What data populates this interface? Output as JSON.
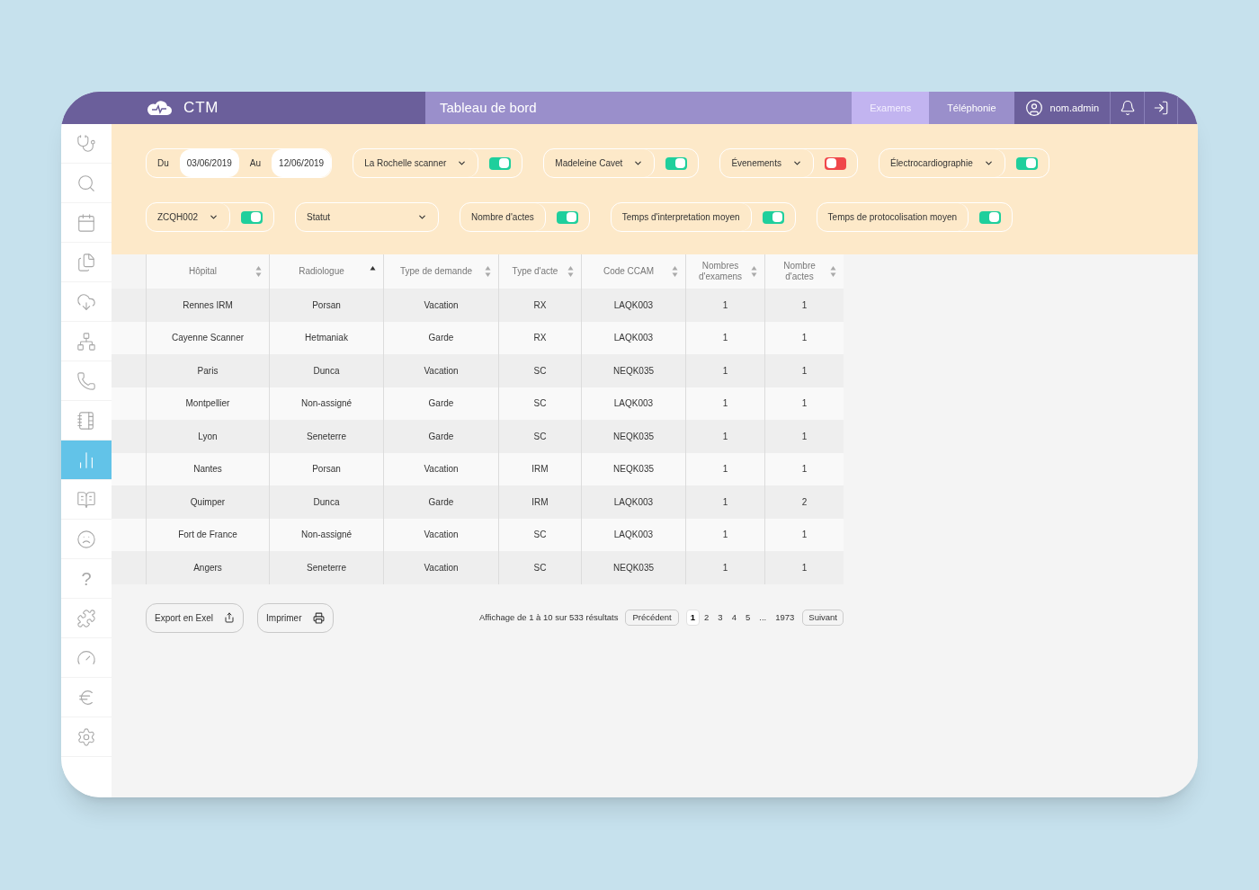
{
  "header": {
    "logo_text": "CTM",
    "title": "Tableau de bord",
    "tabs": [
      {
        "label": "Examens",
        "selected": true
      },
      {
        "label": "Téléphonie",
        "selected": false
      }
    ],
    "user": "nom.admin"
  },
  "sidebar": {
    "items": [
      {
        "selected": false
      },
      {
        "selected": false
      },
      {
        "selected": false
      },
      {
        "selected": false
      },
      {
        "selected": false
      },
      {
        "selected": false
      },
      {
        "selected": false
      },
      {
        "selected": false
      },
      {
        "selected": true
      },
      {
        "selected": false
      },
      {
        "selected": false
      },
      {
        "glyph": "?",
        "selected": false
      },
      {
        "selected": false
      },
      {
        "selected": false
      },
      {
        "selected": false
      },
      {
        "selected": false
      }
    ]
  },
  "filter_rows": [
    [
      {
        "kind": "date-range",
        "from_label": "Du",
        "from": "03/06/2019",
        "to_label": "Au",
        "to": "12/06/2019"
      },
      {
        "kind": "select-toggle",
        "label": "La Rochelle scanner",
        "on": true
      },
      {
        "kind": "select-toggle",
        "label": "Madeleine Cavet",
        "on": true
      },
      {
        "kind": "select-toggle",
        "label": "Évenements",
        "on": false
      },
      {
        "kind": "select-toggle",
        "label": "Électrocardiographie",
        "on": true
      }
    ],
    [
      {
        "kind": "select-toggle",
        "label": "ZCQH002",
        "on": true
      },
      {
        "kind": "select",
        "label": "Statut"
      },
      {
        "kind": "toggle",
        "label": "Nombre d'actes",
        "on": true
      },
      {
        "kind": "toggle",
        "label": "Temps d'interpretation moyen",
        "on": true
      },
      {
        "kind": "toggle",
        "label": "Temps de protocolisation moyen",
        "on": true
      }
    ]
  ],
  "table": {
    "columns": [
      {
        "label": "Hôpital",
        "sorted": false
      },
      {
        "label": "Radiologue",
        "sorted": true
      },
      {
        "label": "Type de demande",
        "sorted": false
      },
      {
        "label": "Type d'acte",
        "sorted": false
      },
      {
        "label": "Code CCAM",
        "sorted": false
      },
      {
        "label": "Nombres d'examens",
        "sorted": false
      },
      {
        "label": "Nombre d'actes",
        "sorted": false
      }
    ],
    "rows": [
      [
        "Rennes IRM",
        "Porsan",
        "Vacation",
        "RX",
        "LAQK003",
        "1",
        "1"
      ],
      [
        "Cayenne Scanner",
        "Hetmaniak",
        "Garde",
        "RX",
        "LAQK003",
        "1",
        "1"
      ],
      [
        "Paris",
        "Dunca",
        "Vacation",
        "SC",
        "NEQK035",
        "1",
        "1"
      ],
      [
        "Montpellier",
        "Non-assigné",
        "Garde",
        "SC",
        "LAQK003",
        "1",
        "1"
      ],
      [
        "Lyon",
        "Seneterre",
        "Garde",
        "SC",
        "NEQK035",
        "1",
        "1"
      ],
      [
        "Nantes",
        "Porsan",
        "Vacation",
        "IRM",
        "NEQK035",
        "1",
        "1"
      ],
      [
        "Quimper",
        "Dunca",
        "Garde",
        "IRM",
        "LAQK003",
        "1",
        "2"
      ],
      [
        "Fort de France",
        "Non-assigné",
        "Vacation",
        "SC",
        "LAQK003",
        "1",
        "1"
      ],
      [
        "Angers",
        "Seneterre",
        "Vacation",
        "SC",
        "NEQK035",
        "1",
        "1"
      ]
    ]
  },
  "footer": {
    "buttons": [
      {
        "label": "Export en Exel"
      },
      {
        "label": "Imprimer"
      }
    ],
    "summary": "Affichage de 1 à 10 sur 533 résultats",
    "previous": "Précédent",
    "pages": [
      {
        "label": "1",
        "selected": true
      },
      {
        "label": "2",
        "selected": false
      },
      {
        "label": "3",
        "selected": false
      },
      {
        "label": "4",
        "selected": false
      },
      {
        "label": "5",
        "selected": false
      },
      {
        "label": "...",
        "selected": false
      },
      {
        "label": "1973",
        "selected": false
      }
    ],
    "next": "Suivant"
  }
}
